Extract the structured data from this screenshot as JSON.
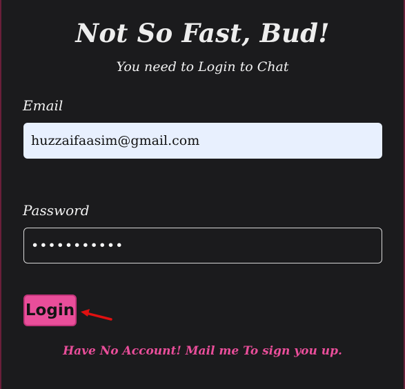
{
  "header": {
    "title": "Not So Fast, Bud!",
    "subtitle": "You need to Login to Chat"
  },
  "form": {
    "email_label": "Email",
    "email_value": "huzzaifaasim@gmail.com",
    "password_label": "Password",
    "password_value": "•••••••••••",
    "login_label": "Login"
  },
  "footer": {
    "signup_text": "Have No Account! Mail me To sign you up."
  },
  "icons": {
    "pointer": "arrow-icon"
  },
  "colors": {
    "background": "#1b1b1d",
    "accent_pink": "#e94e9a",
    "autofill_blue": "#e8f0fe",
    "annotation_red": "#e01010"
  }
}
